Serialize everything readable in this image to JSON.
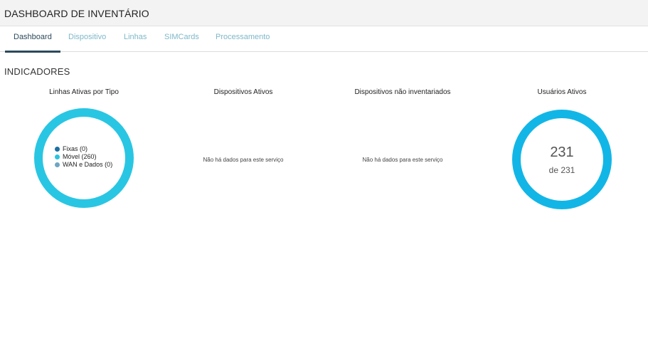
{
  "header": {
    "title": "DASHBOARD DE INVENTÁRIO"
  },
  "tabs": [
    {
      "label": "Dashboard",
      "active": true
    },
    {
      "label": "Dispositivo",
      "active": false
    },
    {
      "label": "Linhas",
      "active": false
    },
    {
      "label": "SIMCards",
      "active": false
    },
    {
      "label": "Processamento",
      "active": false
    }
  ],
  "section": {
    "title": "INDICADORES"
  },
  "cards": {
    "lines": {
      "title": "Linhas Ativas por Tipo",
      "legend": [
        {
          "label": "Fixas (0)",
          "color": "#1a6fa3"
        },
        {
          "label": "Móvel (260)",
          "color": "#2bc4dd"
        },
        {
          "label": "WAN e Dados (0)",
          "color": "#6fa5c2"
        }
      ],
      "ring_color": "#29c6e3"
    },
    "devices": {
      "title": "Dispositivos Ativos",
      "empty_text": "Não há dados para este serviço"
    },
    "uninventoried": {
      "title": "Dispositivos não inventariados",
      "empty_text": "Não há dados para este serviço"
    },
    "users": {
      "title": "Usuários Ativos",
      "count": "231",
      "total": "de 231",
      "ring_color": "#12b6e6"
    }
  }
}
